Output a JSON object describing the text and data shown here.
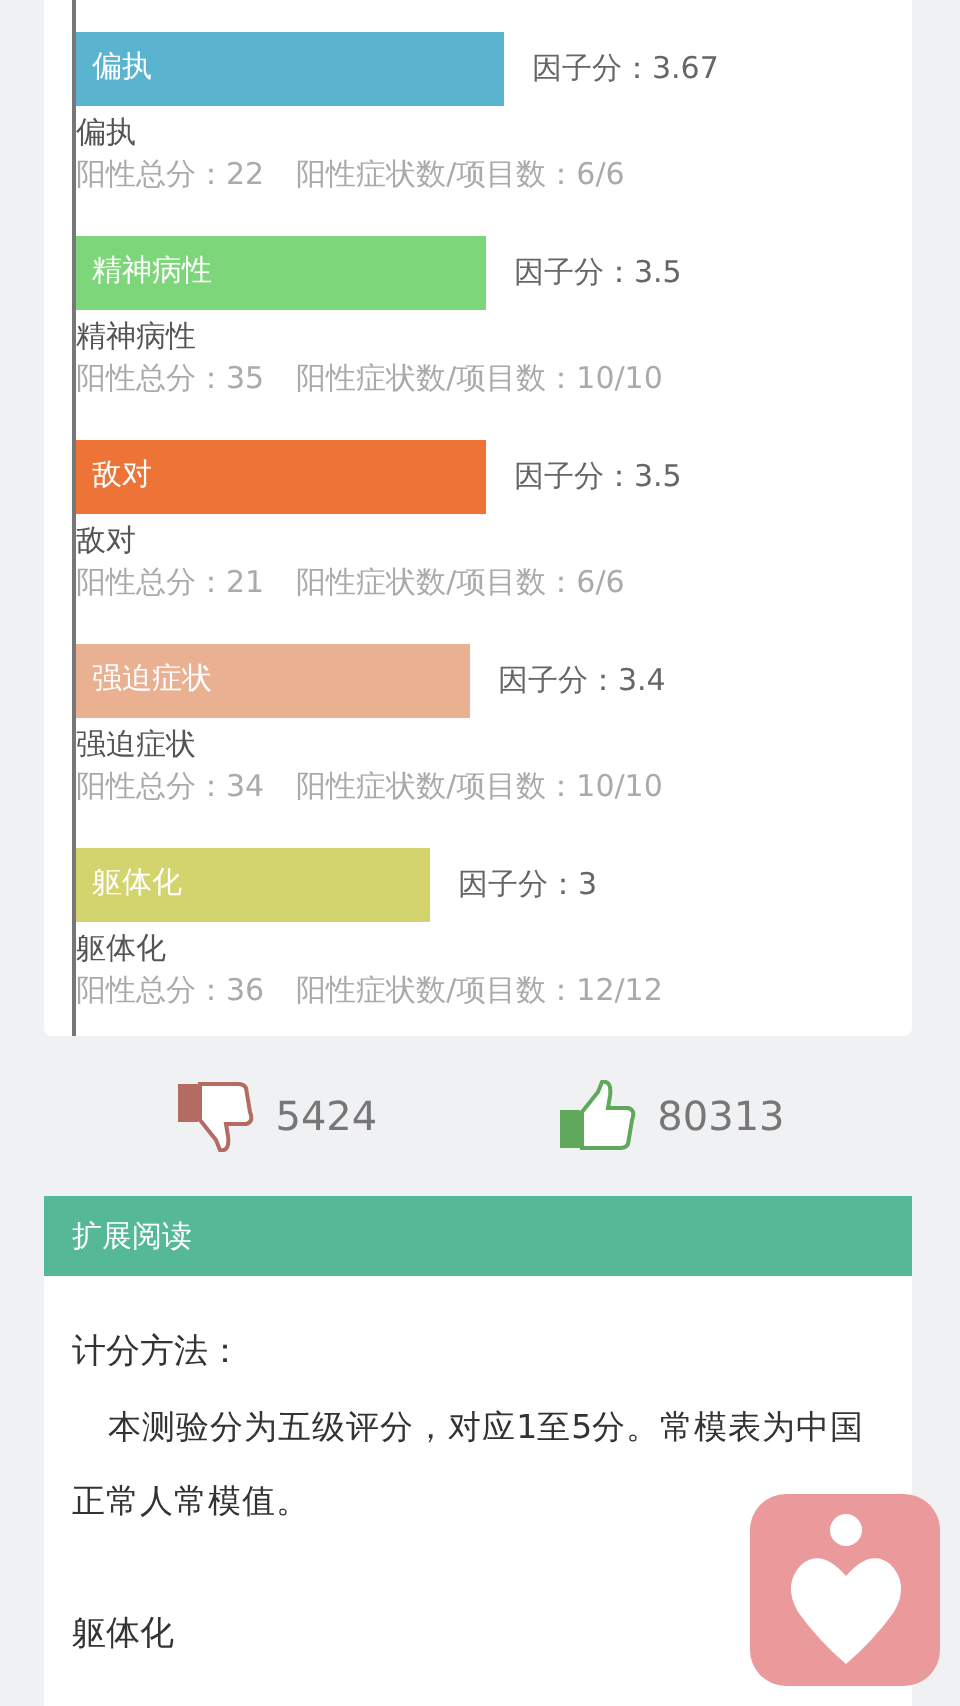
{
  "factors": [
    {
      "name": "偏执",
      "color": "#5ab4d0",
      "score": "因子分：3.67",
      "label": "偏执",
      "total": "阳性总分：22",
      "count": "阳性症状数/项目数：6/6"
    },
    {
      "name": "精神病性",
      "color": "#7ed67a",
      "score": "因子分：3.5",
      "label": "精神病性",
      "total": "阳性总分：35",
      "count": "阳性症状数/项目数：10/10"
    },
    {
      "name": "敌对",
      "color": "#ee7337",
      "score": "因子分：3.5",
      "label": "敌对",
      "total": "阳性总分：21",
      "count": "阳性症状数/项目数：6/6"
    },
    {
      "name": "强迫症状",
      "color": "#eab092",
      "score": "因子分：3.4",
      "label": "强迫症状",
      "total": "阳性总分：34",
      "count": "阳性症状数/项目数：10/10"
    },
    {
      "name": "躯体化",
      "color": "#d3d46e",
      "score": "因子分：3",
      "label": "躯体化",
      "total": "阳性总分：36",
      "count": "阳性症状数/项目数：12/12"
    }
  ],
  "votes": {
    "dislikes": "5424",
    "likes": "80313"
  },
  "reading": {
    "title": "扩展阅读",
    "heading": "计分方法：",
    "paragraph": "本测验分为五级评分，对应1至5分。常模表为中国正常人常模值。",
    "subheading": "躯体化"
  }
}
